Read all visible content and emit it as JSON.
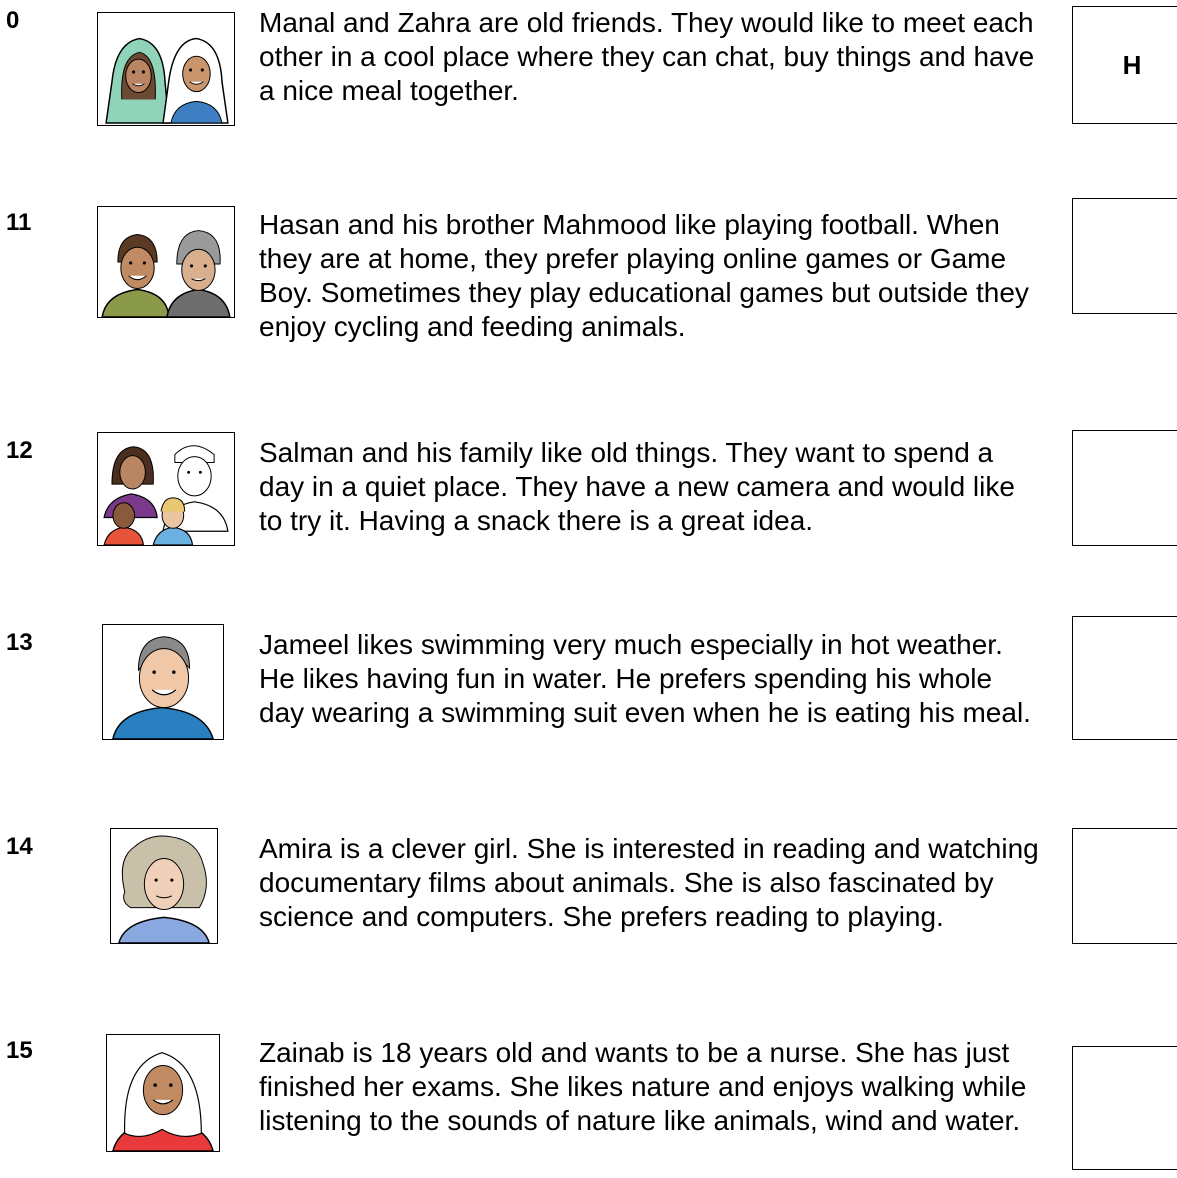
{
  "items": [
    {
      "number": "0",
      "text": "Manal and Zahra are old friends. They would like to meet each other in a cool place where they can chat, buy things and have a nice meal together.",
      "answer": "H",
      "image": "two-girls-in-headscarves-icon"
    },
    {
      "number": "11",
      "text": "Hasan and his brother Mahmood like playing football. When they are at home, they prefer playing online games or Game Boy. Sometimes they play educational games but outside they enjoy cycling and feeding animals.",
      "answer": "",
      "image": "two-boys-icon"
    },
    {
      "number": "12",
      "text": "Salman and his family like old things. They want to spend a day in a quiet place. They have a new camera and would like to try it. Having a snack there is a great idea.",
      "answer": "",
      "image": "family-icon"
    },
    {
      "number": "13",
      "text": "Jameel likes swimming very much especially in hot weather. He likes having fun in water. He prefers spending his whole day wearing a swimming suit even when he is eating his meal.",
      "answer": "",
      "image": "smiling-man-icon"
    },
    {
      "number": "14",
      "text": "Amira is a clever girl. She is interested in reading and watching documentary films about animals. She is also fascinated by science and computers. She prefers reading to playing.",
      "answer": "",
      "image": "curly-haired-girl-icon"
    },
    {
      "number": "15",
      "text": "Zainab is 18 years old and wants to be a nurse. She has just finished her exams. She likes nature and enjoys walking while listening to the sounds of nature like animals, wind and water.",
      "answer": "",
      "image": "woman-in-headscarf-icon"
    }
  ]
}
